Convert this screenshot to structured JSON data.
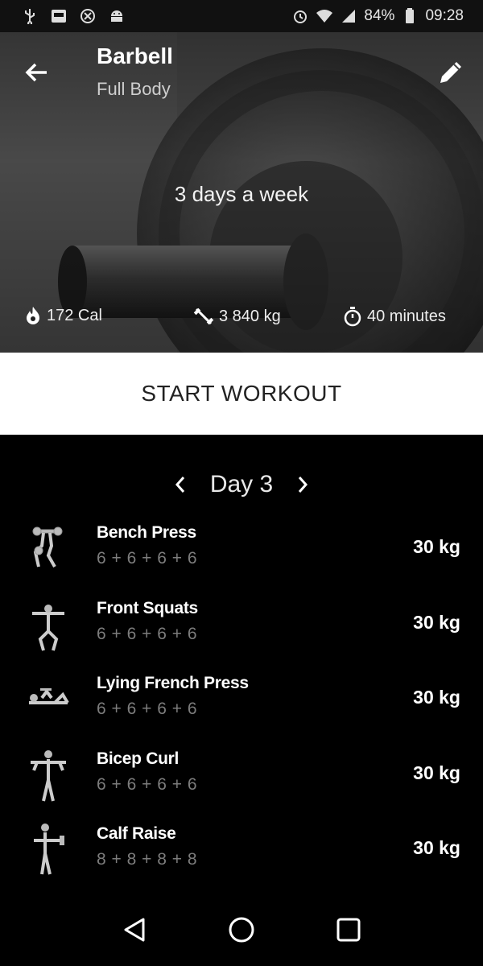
{
  "status_bar": {
    "battery": "84%",
    "time": "09:28",
    "left_icons": [
      "usb-icon",
      "image-icon",
      "sync-icon",
      "android-icon"
    ],
    "right_icons": [
      "alarm-icon",
      "wifi-icon",
      "signal-icon",
      "battery-icon"
    ]
  },
  "header": {
    "title": "Barbell",
    "subtitle": "Full Body",
    "frequency": "3 days a week",
    "back_icon": "arrow-back-icon",
    "edit_icon": "pencil-icon"
  },
  "stats": {
    "calories": "172 Cal",
    "volume": "3 840 kg",
    "duration": "40 minutes"
  },
  "start_button": "START WORKOUT",
  "day_selector": {
    "label": "Day 3"
  },
  "exercises": [
    {
      "name": "Bench Press",
      "reps": "6 + 6 + 6 + 6",
      "weight": "30 kg"
    },
    {
      "name": "Front Squats",
      "reps": "6 + 6 + 6 + 6",
      "weight": "30 kg"
    },
    {
      "name": "Lying French Press",
      "reps": "6 + 6 + 6 + 6",
      "weight": "30 kg"
    },
    {
      "name": "Bicep Curl",
      "reps": "6 + 6 + 6 + 6",
      "weight": "30 kg"
    },
    {
      "name": "Calf Raise",
      "reps": "8 + 8 + 8 + 8",
      "weight": "30 kg"
    }
  ],
  "nav": [
    "back-triangle-icon",
    "home-circle-icon",
    "recents-square-icon"
  ]
}
